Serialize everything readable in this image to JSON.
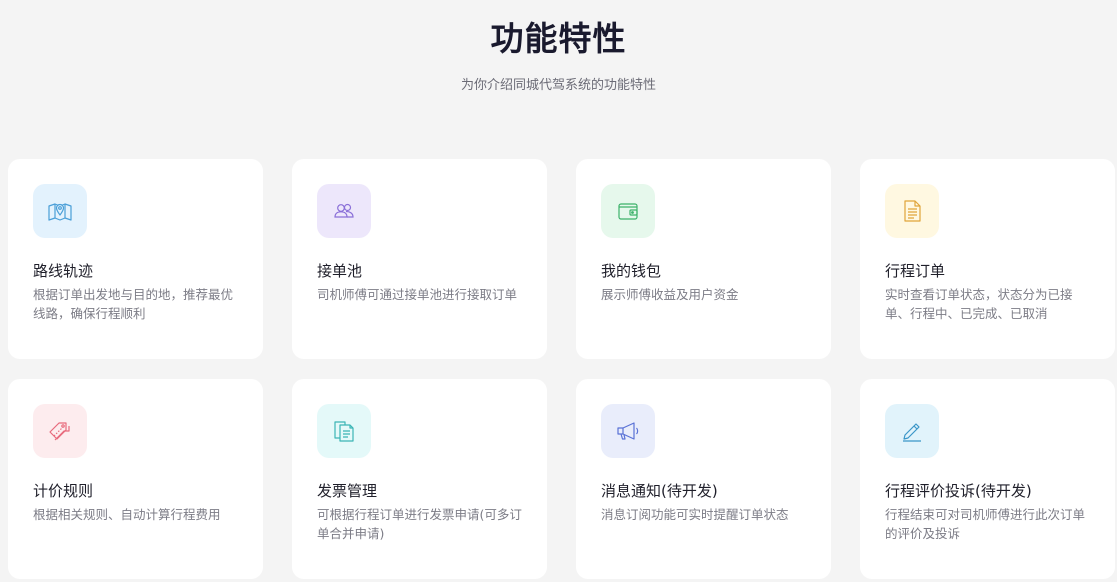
{
  "header": {
    "title": "功能特性",
    "subtitle": "为你介绍同城代驾系统的功能特性"
  },
  "features": [
    {
      "title": "路线轨迹",
      "desc": "根据订单出发地与目的地，推荐最优线路，确保行程顺利",
      "icon": "map-pin-icon",
      "icon_color": "#4a9fd8",
      "icon_bg": "#e3f2fd"
    },
    {
      "title": "接单池",
      "desc": "司机师傅可通过接单池进行接取订单",
      "icon": "users-icon",
      "icon_color": "#8a6fd8",
      "icon_bg": "#ede7fb"
    },
    {
      "title": "我的钱包",
      "desc": "展示师傅收益及用户资金",
      "icon": "wallet-icon",
      "icon_color": "#3db26a",
      "icon_bg": "#e6f8ec"
    },
    {
      "title": "行程订单",
      "desc": "实时查看订单状态，状态分为已接单、行程中、已完成、已取消",
      "icon": "document-icon",
      "icon_color": "#e0a43a",
      "icon_bg": "#fff8e1"
    },
    {
      "title": "计价规则",
      "desc": "根据相关规则、自动计算行程费用",
      "icon": "price-tag-icon",
      "icon_color": "#e86a7c",
      "icon_bg": "#fdecee"
    },
    {
      "title": "发票管理",
      "desc": "可根据行程订单进行发票申请(可多订单合并申请)",
      "icon": "invoice-icon",
      "icon_color": "#3ab5b5",
      "icon_bg": "#e4f9f9"
    },
    {
      "title": "消息通知(待开发)",
      "desc": "消息订阅功能可实时提醒订单状态",
      "icon": "megaphone-icon",
      "icon_color": "#5a72d6",
      "icon_bg": "#e9edfb"
    },
    {
      "title": "行程评价投诉(待开发)",
      "desc": "行程结束可对司机师傅进行此次订单的评价及投诉",
      "icon": "pencil-icon",
      "icon_color": "#3a96c8",
      "icon_bg": "#e1f3fb"
    }
  ]
}
